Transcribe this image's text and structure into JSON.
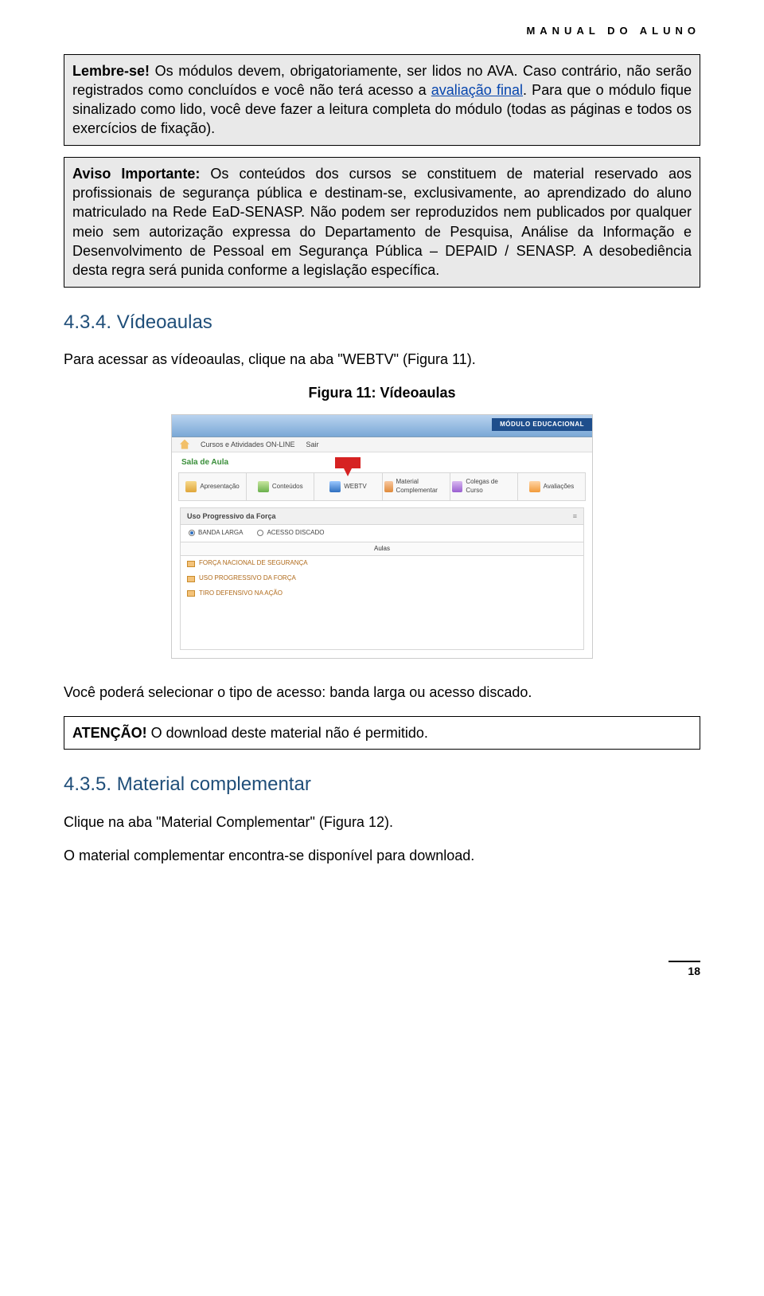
{
  "header": {
    "title": "MANUAL DO ALUNO"
  },
  "box1": {
    "strong": "Lembre-se!",
    "p1a": " Os módulos devem, obrigatoriamente, ser lidos no AVA. Caso contrário, não serão registrados como concluídos e você não terá acesso a ",
    "link": "avaliação final",
    "p1b": ". Para que o módulo fique sinalizado como lido, você deve fazer a leitura completa do módulo (todas as páginas e todos os exercícios de fixação)."
  },
  "box2": {
    "strong": "Aviso Importante:",
    "text": " Os conteúdos dos cursos se constituem de material reservado aos profissionais de segurança pública e destinam-se, exclusivamente, ao aprendizado do aluno matriculado na Rede EaD-SENASP. Não podem ser reproduzidos nem publicados por qualquer meio sem autorização expressa do Departamento de Pesquisa, Análise da Informação e Desenvolvimento de Pessoal em Segurança Pública – DEPAID / SENASP. A desobediência desta regra será punida conforme a legislação específica."
  },
  "sec434": {
    "title": "4.3.4. Vídeoaulas",
    "intro": "Para acessar as vídeoaulas, clique na aba \"WEBTV\" (Figura 11).",
    "figcap": "Figura 11: Vídeoaulas"
  },
  "app": {
    "modulo_label": "MÓDULO EDUCACIONAL",
    "menu_cursos": "Cursos e Atividades ON-LINE",
    "menu_sair": "Sair",
    "sala": "Sala de Aula",
    "tabs": {
      "apresentacao": "Apresentação",
      "conteudos": "Conteúdos",
      "webtv": "WEBTV",
      "material": "Material Complementar",
      "colegas": "Colegas de Curso",
      "avaliacoes": "Avaliações"
    },
    "panel_title": "Uso Progressivo da Força",
    "radio_banda": "BANDA LARGA",
    "radio_discado": "ACESSO DISCADO",
    "aulas_hdr": "Aulas",
    "items": [
      "FORÇA NACIONAL DE SEGURANÇA",
      "USO PROGRESSIVO DA FORÇA",
      "TIRO DEFENSIVO NA AÇÃO"
    ]
  },
  "after_fig": "Você poderá selecionar o tipo de acesso: banda larga ou acesso discado.",
  "atencao": {
    "strong": "ATENÇÃO!",
    "text": " O download deste material não é permitido."
  },
  "sec435": {
    "title": "4.3.5. Material complementar",
    "p1": "Clique na aba \"Material Complementar\" (Figura 12).",
    "p2": "O material complementar encontra-se disponível para download."
  },
  "page_number": "18"
}
